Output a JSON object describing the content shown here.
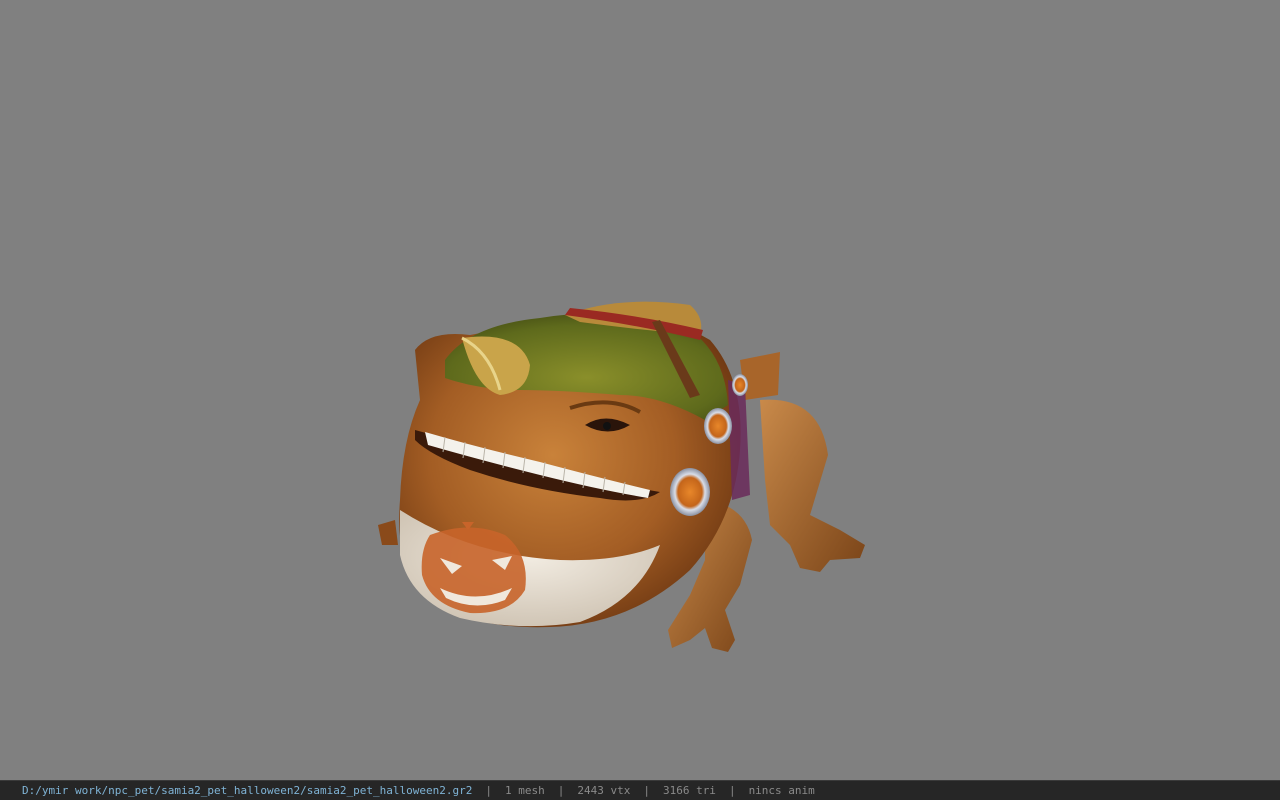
{
  "viewport": {
    "background": "#808080",
    "model_name": "samia2_pet_halloween2"
  },
  "status_bar": {
    "path": "D:/ymir work/npc_pet/samia2_pet_halloween2/samia2_pet_halloween2.gr2",
    "separator": "|",
    "mesh": "1 mesh",
    "vertices": "2443 vtx",
    "triangles": "3166 tri",
    "anim": "nincs anim",
    "path_color": "#7fb3d5",
    "text_color": "#8a8a8a"
  }
}
